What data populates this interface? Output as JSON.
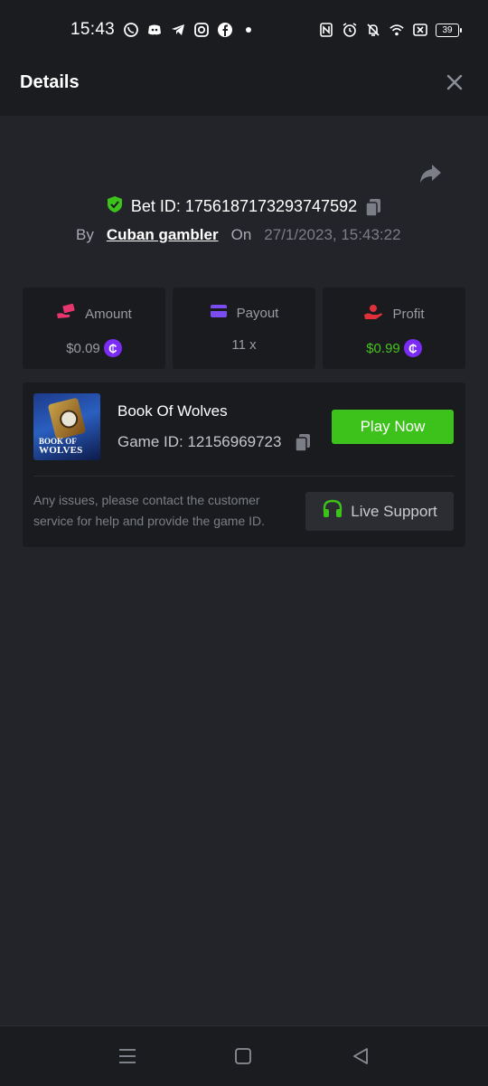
{
  "status_bar": {
    "time": "15:43",
    "left_icons": [
      "whatsapp-icon",
      "discord-icon",
      "telegram-icon",
      "instagram-icon",
      "facebook-icon",
      "dot-icon"
    ],
    "right_icons": [
      "nfc-icon",
      "alarm-icon",
      "mute-icon",
      "wifi-icon",
      "sim-off-icon"
    ],
    "battery": "39"
  },
  "header": {
    "title": "Details"
  },
  "bet": {
    "id_label": "Bet ID: 1756187173293747592",
    "by_label": "By",
    "user": "Cuban gambler",
    "on_label": "On",
    "date": "27/1/2023, 15:43:22"
  },
  "stats": [
    {
      "label": "Amount",
      "value": "$0.09",
      "icon": "money-hand-icon",
      "color": "#e8356d"
    },
    {
      "label": "Payout",
      "value": "11 x",
      "icon": "card-icon",
      "color": "#7b4cf0"
    },
    {
      "label": "Profit",
      "value": "$0.99",
      "icon": "profit-hand-icon",
      "color": "#e0303a"
    }
  ],
  "game": {
    "thumb_line1": "BOOK OF",
    "thumb_line2": "WOLVES",
    "name": "Book Of Wolves",
    "id_label": "Game ID: 12156969723",
    "play_label": "Play Now",
    "help_text": "Any issues, please contact the customer service for help and provide the game ID.",
    "support_label": "Live Support"
  },
  "colors": {
    "accent_green": "#3cc21a",
    "coin_purple": "#7a2cf5",
    "background": "#232429"
  },
  "coin_symbol": "₵"
}
